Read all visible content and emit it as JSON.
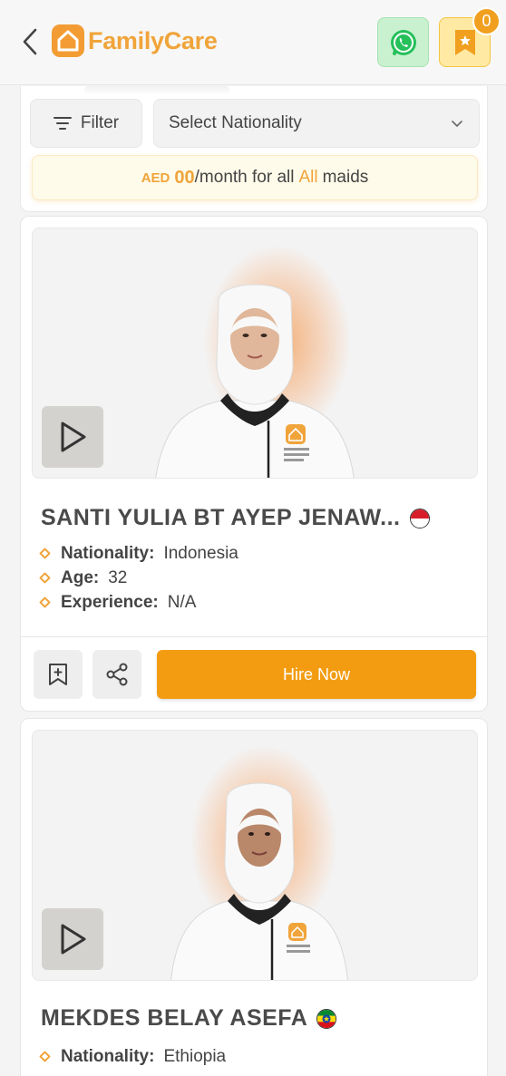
{
  "header": {
    "brand": "FamilyCare",
    "bookmark_count": "0",
    "brand_color": "#f0a43a"
  },
  "filters": {
    "filter_label": "Filter",
    "nationality_placeholder": "Select Nationality"
  },
  "promo": {
    "currency": "AED",
    "amount": "00",
    "text_before": "/month for all",
    "highlight": "All",
    "text_after": "maids"
  },
  "maids": [
    {
      "name": "SANTI YULIA BT AYEP JENAW...",
      "flag": "indonesia-flag",
      "nationality_label": "Nationality:",
      "nationality": "Indonesia",
      "age_label": "Age:",
      "age": "32",
      "experience_label": "Experience:",
      "experience": "N/A",
      "hire_label": "Hire Now"
    },
    {
      "name": "MEKDES BELAY ASEFA",
      "flag": "ethiopia-flag",
      "nationality_label": "Nationality:",
      "nationality": "Ethiopia"
    }
  ]
}
